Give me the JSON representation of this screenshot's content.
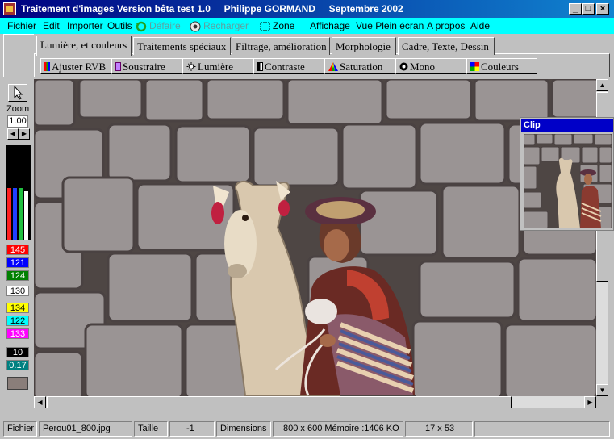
{
  "window": {
    "title": "Traitement d'images Version bêta test 1.0     Philippe GORMAND     Septembre 2002",
    "controls": [
      "_",
      "□",
      "×"
    ]
  },
  "menu": [
    {
      "label": "Fichier",
      "icon": "",
      "enabled": true
    },
    {
      "label": "Edit",
      "icon": "",
      "enabled": true
    },
    {
      "label": "Importer",
      "icon": "",
      "enabled": true
    },
    {
      "label": "Outils",
      "icon": "",
      "enabled": true
    },
    {
      "label": "Défaire",
      "icon": "undo-icon",
      "enabled": false
    },
    {
      "label": "Recharger",
      "icon": "reload-icon",
      "enabled": false
    },
    {
      "label": "Zone",
      "icon": "zone-select-icon",
      "enabled": true
    },
    {
      "label": "Affichage",
      "icon": "",
      "enabled": true
    },
    {
      "label": "Vue Plein écran",
      "icon": "",
      "enabled": true
    },
    {
      "label": "A propos",
      "icon": "",
      "enabled": true
    },
    {
      "label": "Aide",
      "icon": "",
      "enabled": true
    }
  ],
  "tabs": [
    {
      "label": "Lumière, et couleurs",
      "active": true
    },
    {
      "label": "Traitements spéciaux",
      "active": false
    },
    {
      "label": "Filtrage, amélioration",
      "active": false
    },
    {
      "label": "Morphologie",
      "active": false
    },
    {
      "label": "Cadre, Texte, Dessin",
      "active": false
    }
  ],
  "tools": [
    {
      "label": "Ajuster RVB",
      "icon": "rgb-icon"
    },
    {
      "label": "Soustraire",
      "icon": "subtract-icon"
    },
    {
      "label": "Lumière",
      "icon": "light-icon"
    },
    {
      "label": "Contraste",
      "icon": "contrast-icon"
    },
    {
      "label": "Saturation",
      "icon": "saturation-icon"
    },
    {
      "label": "Mono",
      "icon": "mono-icon"
    },
    {
      "label": "Couleurs",
      "icon": "colors-icon"
    }
  ],
  "sidebar": {
    "zoom_label": "Zoom",
    "zoom_value": "1.00",
    "meters": {
      "red": 0.55,
      "green": 0.55,
      "blue": 0.55,
      "lum": 0.52
    },
    "values": [
      {
        "text": "145",
        "bg": "#ff0000",
        "fg": "#ffffff"
      },
      {
        "text": "121",
        "bg": "#0000ff",
        "fg": "#ffffff"
      },
      {
        "text": "124",
        "bg": "#008000",
        "fg": "#ffffff"
      },
      {
        "text": "130",
        "bg": "#ffffff",
        "fg": "#000000"
      },
      {
        "text": "134",
        "bg": "#ffff00",
        "fg": "#000000"
      },
      {
        "text": "122",
        "bg": "#00ffff",
        "fg": "#000000"
      },
      {
        "text": "133",
        "bg": "#ff00ff",
        "fg": "#ffffff"
      },
      {
        "text": "10",
        "bg": "#000000",
        "fg": "#ffffff"
      },
      {
        "text": "0.17",
        "bg": "#008080",
        "fg": "#ffffff"
      }
    ],
    "swatch_color": "#8a7e7a"
  },
  "clip": {
    "title": "Clip"
  },
  "status": [
    {
      "text": "Fichier"
    },
    {
      "text": "Perou01_800.jpg"
    },
    {
      "text": "Taille"
    },
    {
      "text": "-1"
    },
    {
      "text": "Dimensions"
    },
    {
      "text": "800 x 600 Mémoire :1406 KO"
    },
    {
      "text": "17 x 53"
    },
    {
      "text": ""
    }
  ]
}
